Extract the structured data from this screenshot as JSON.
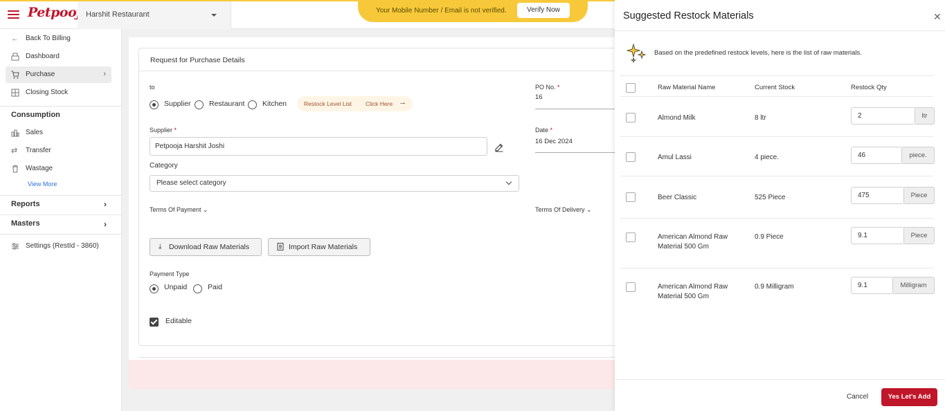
{
  "header": {
    "logo": "Petpooja",
    "restaurant": "Harshit Restaurant",
    "verify_message": "Your Mobile Number / Email is not verified.",
    "verify_button": "Verify Now"
  },
  "sidebar": {
    "items": [
      {
        "label": "Back To Billing",
        "icon": "arrow-left-icon"
      },
      {
        "label": "Dashboard",
        "icon": "dashboard-icon"
      },
      {
        "label": "Purchase",
        "icon": "cart-icon"
      },
      {
        "label": "Closing Stock",
        "icon": "closing-stock-icon"
      }
    ],
    "consumption_title": "Consumption",
    "consumption_items": [
      {
        "label": "Sales",
        "icon": "sales-icon"
      },
      {
        "label": "Transfer",
        "icon": "transfer-icon"
      },
      {
        "label": "Wastage",
        "icon": "trash-icon"
      }
    ],
    "view_more": "View More",
    "reports": "Reports",
    "masters": "Masters",
    "settings": "Settings (RestId - 3860)"
  },
  "form": {
    "title": "Request for Purchase Details",
    "to_label": "to",
    "to_options": [
      "Supplier",
      "Restaurant",
      "Kitchen"
    ],
    "to_selected": "Supplier",
    "restock_level_list": "Restock Level List",
    "click_here": "Click Here",
    "po_label": "PO No.",
    "po_value": "16",
    "supplier_label": "Supplier",
    "supplier_value": "Petpooja Harshit Joshi",
    "date_label": "Date",
    "date_value": "16 Dec 2024",
    "category_label": "Category",
    "category_placeholder": "Please select category",
    "terms_payment": "Terms Of Payment",
    "terms_delivery": "Terms Of Delivery",
    "download_btn": "Download Raw Materials",
    "import_btn": "Import Raw Materials",
    "payment_type_label": "Payment Type",
    "payment_options": [
      "Unpaid",
      "Paid"
    ],
    "payment_selected": "Unpaid",
    "editable_label": "Editable",
    "required_mark": "*"
  },
  "drawer": {
    "title": "Suggested Restock Materials",
    "info": "Based on the predefined restock levels, here is the list of raw materials.",
    "columns": [
      "Raw Material Name",
      "Current Stock",
      "Restock Qty"
    ],
    "rows": [
      {
        "name": "Almond Milk",
        "stock": "8 ltr",
        "qty": "2",
        "unit": "ltr"
      },
      {
        "name": "Amul Lassi",
        "stock": "4 piece.",
        "qty": "46",
        "unit": "piece."
      },
      {
        "name": "Beer Classic",
        "stock": "525 Piece",
        "qty": "475",
        "unit": "Piece"
      },
      {
        "name": "American Almond Raw Material 500 Gm",
        "stock": "0.9 Piece",
        "qty": "9.1",
        "unit": "Piece"
      },
      {
        "name": "American Almond Raw Material 500 Gm",
        "stock": "0.9 Milligram",
        "qty": "9.1",
        "unit": "Milligram"
      }
    ],
    "cancel": "Cancel",
    "confirm": "Yes Let's Add"
  }
}
